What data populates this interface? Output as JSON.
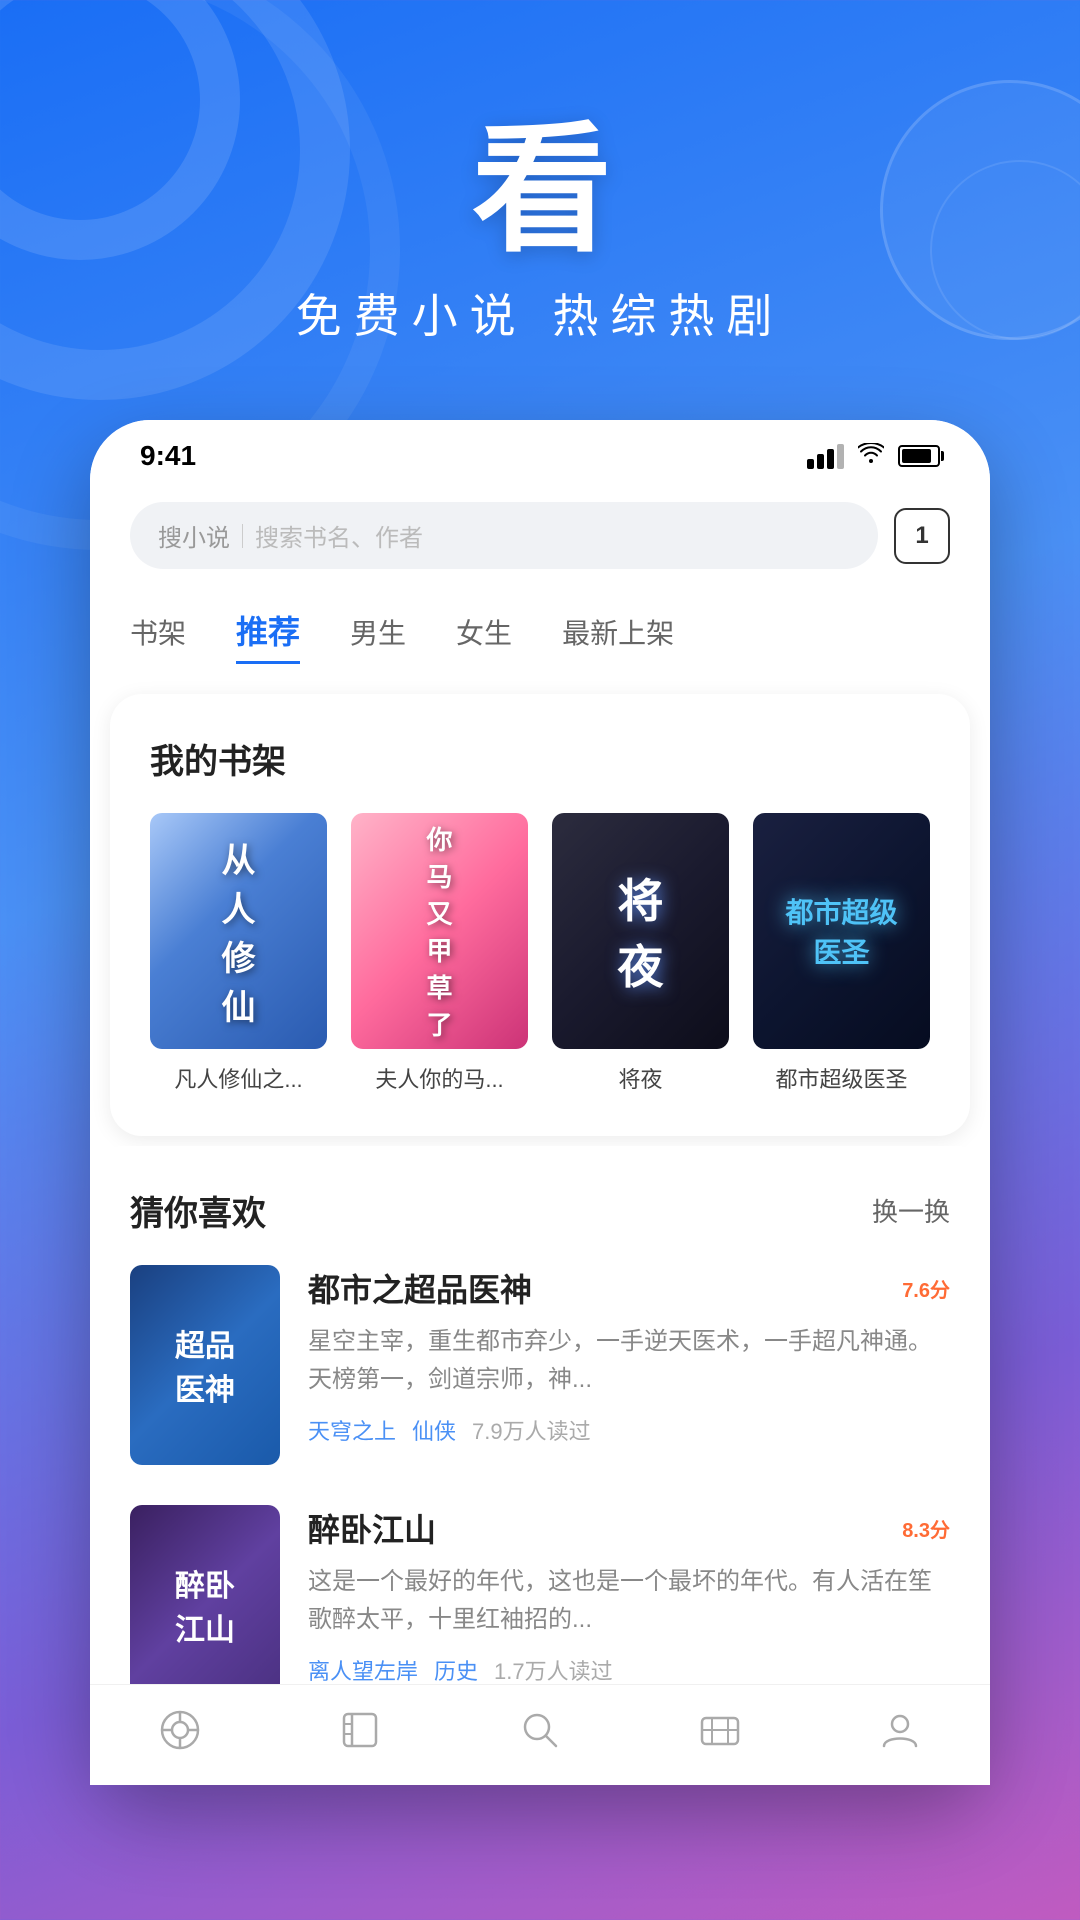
{
  "app": {
    "title": "看",
    "subtitle": "免费小说  热综热剧"
  },
  "status_bar": {
    "time": "9:41",
    "badge_count": "1"
  },
  "search": {
    "label": "搜小说",
    "placeholder": "搜索书名、作者"
  },
  "tabs": [
    {
      "id": "bookshelf",
      "label": "书架",
      "active": false
    },
    {
      "id": "recommend",
      "label": "推荐",
      "active": true
    },
    {
      "id": "male",
      "label": "男生",
      "active": false
    },
    {
      "id": "female",
      "label": "女生",
      "active": false
    },
    {
      "id": "new",
      "label": "最新上架",
      "active": false
    }
  ],
  "bookshelf": {
    "title": "我的书架",
    "books": [
      {
        "id": 1,
        "name": "凡人修仙之...",
        "cover_type": "cover1"
      },
      {
        "id": 2,
        "name": "夫人你的马...",
        "cover_type": "cover2"
      },
      {
        "id": 3,
        "name": "将夜",
        "cover_type": "cover3"
      },
      {
        "id": 4,
        "name": "都市超级医圣",
        "cover_type": "cover4"
      }
    ]
  },
  "recommendations": {
    "title": "猜你喜欢",
    "refresh_label": "换一换",
    "items": [
      {
        "id": 1,
        "title": "都市之超品医神",
        "score": "7.6",
        "score_unit": "分",
        "desc": "星空主宰，重生都市弃少，一手逆天医术，一手超凡神通。天榜第一，剑道宗师，神...",
        "tags": [
          "天穹之上",
          "仙侠"
        ],
        "readers": "7.9万人读过",
        "cover_type": "rec_cover1"
      },
      {
        "id": 2,
        "title": "醉卧江山",
        "score": "8.3",
        "score_unit": "分",
        "desc": "这是一个最好的年代，这也是一个最坏的年代。有人活在笙歌醉太平，十里红袖招的...",
        "tags": [
          "离人望左岸",
          "历史"
        ],
        "readers": "1.7万人读过",
        "cover_type": "rec_cover2"
      }
    ]
  },
  "bottom_nav": [
    {
      "id": "home",
      "icon": "home-icon",
      "label": ""
    },
    {
      "id": "books",
      "icon": "book-icon",
      "label": ""
    },
    {
      "id": "search",
      "icon": "search-icon",
      "label": ""
    },
    {
      "id": "library",
      "icon": "library-icon",
      "label": ""
    },
    {
      "id": "profile",
      "icon": "profile-icon",
      "label": ""
    }
  ]
}
